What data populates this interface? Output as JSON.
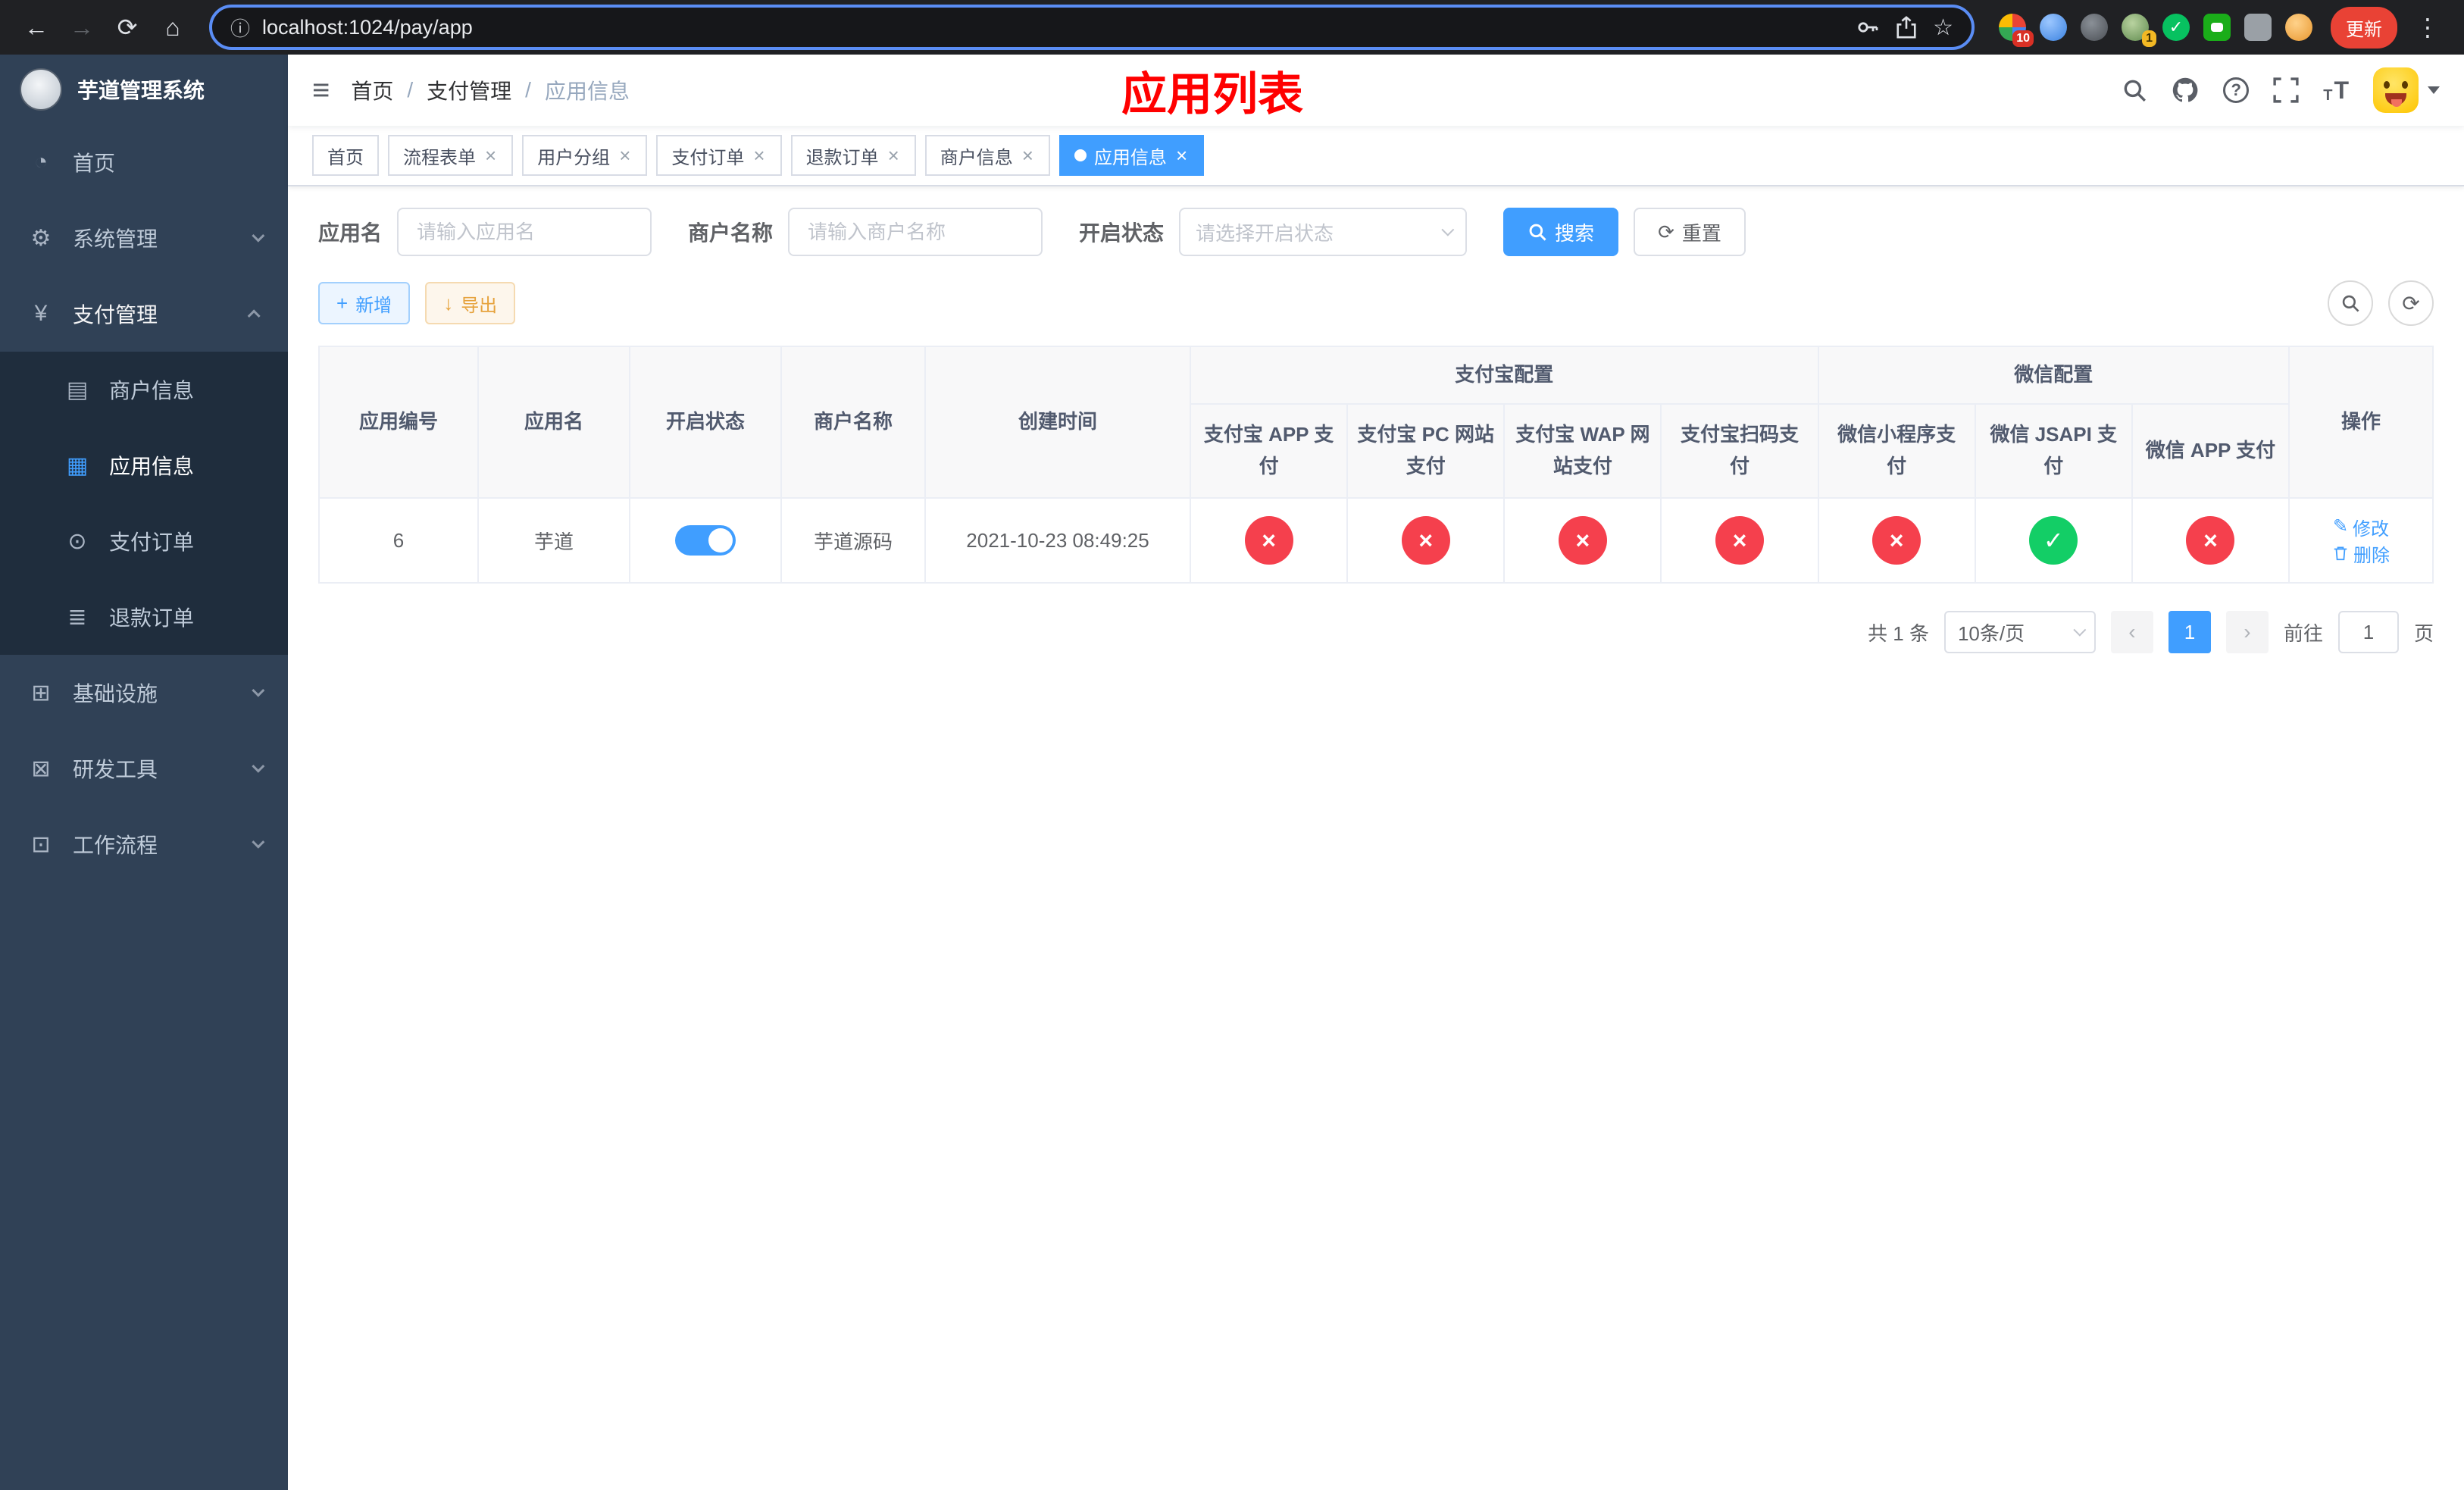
{
  "colors": {
    "accent": "#409eff",
    "success": "#13ce66",
    "danger": "#f5404d",
    "warning": "#e6a23c",
    "title_red": "#ff0000",
    "sidebar_bg": "#304156",
    "submenu_bg": "#1f2d3d",
    "browser_bg": "#202124"
  },
  "icons": {
    "back": "←",
    "forward": "→",
    "reload": "⟳",
    "home": "⌂",
    "site_info": "ⓘ",
    "star": "☆",
    "menu_dots": "⋮",
    "hamburger": "≡",
    "dashboard": "◔",
    "system": "⚙",
    "payment": "¥",
    "merchant": "▤",
    "app": "▦",
    "order": "⊙",
    "refund": "≣",
    "infrastructure": "⊞",
    "devtools": "⊠",
    "workflow": "⊡",
    "help": "?",
    "font_size": "T",
    "plus": "+",
    "download": "↓",
    "refresh": "⟳",
    "edit": "✎",
    "close": "×",
    "success_glyph": "✓",
    "fail_glyph": "×",
    "prev": "‹",
    "next": "›"
  },
  "browser": {
    "url": "localhost:1024/pay/app",
    "update_button": "更新",
    "extension_badge_pinwheel": "10",
    "extension_badge_avatar": "1"
  },
  "sidebar": {
    "app_title": "芋道管理系统",
    "menu": [
      {
        "label": "首页"
      },
      {
        "label": "系统管理"
      },
      {
        "label": "支付管理"
      },
      {
        "label": "基础设施"
      },
      {
        "label": "研发工具"
      },
      {
        "label": "工作流程"
      }
    ],
    "payment_submenu": [
      {
        "label": "商户信息"
      },
      {
        "label": "应用信息",
        "active": true
      },
      {
        "label": "支付订单"
      },
      {
        "label": "退款订单"
      }
    ]
  },
  "header": {
    "breadcrumb": [
      "首页",
      "支付管理",
      "应用信息"
    ],
    "page_title": "应用列表"
  },
  "tabs": [
    {
      "label": "首页",
      "closable": false,
      "active": false
    },
    {
      "label": "流程表单",
      "closable": true,
      "active": false
    },
    {
      "label": "用户分组",
      "closable": true,
      "active": false
    },
    {
      "label": "支付订单",
      "closable": true,
      "active": false
    },
    {
      "label": "退款订单",
      "closable": true,
      "active": false
    },
    {
      "label": "商户信息",
      "closable": true,
      "active": false
    },
    {
      "label": "应用信息",
      "closable": true,
      "active": true
    }
  ],
  "filters": {
    "app_name_label": "应用名",
    "app_name_placeholder": "请输入应用名",
    "merchant_label": "商户名称",
    "merchant_placeholder": "请输入商户名称",
    "status_label": "开启状态",
    "status_placeholder": "请选择开启状态",
    "search_button": "搜索",
    "reset_button": "重置"
  },
  "toolbar": {
    "add_button": "新增",
    "export_button": "导出"
  },
  "table": {
    "headers": {
      "app_id": "应用编号",
      "app_name": "应用名",
      "status": "开启状态",
      "merchant_name": "商户名称",
      "create_time": "创建时间",
      "alipay_group": "支付宝配置",
      "wechat_group": "微信配置",
      "actions": "操作"
    },
    "sub_headers": [
      "支付宝 APP 支付",
      "支付宝 PC 网站支付",
      "支付宝 WAP 网站支付",
      "支付宝扫码支付",
      "微信小程序支付",
      "微信 JSAPI 支付",
      "微信 APP 支付"
    ],
    "row": {
      "app_id": "6",
      "app_name": "芋道",
      "status": "on",
      "merchant_name": "芋道源码",
      "create_time": "2021-10-23 08:49:25",
      "configs": [
        "fail",
        "fail",
        "fail",
        "fail",
        "fail",
        "success",
        "fail"
      ],
      "edit_label": "修改",
      "delete_label": "删除"
    }
  },
  "pagination": {
    "total_text": "共 1 条",
    "page_size": "10条/页",
    "current_page": "1",
    "goto_prefix": "前往",
    "goto_value": "1",
    "goto_suffix": "页"
  }
}
